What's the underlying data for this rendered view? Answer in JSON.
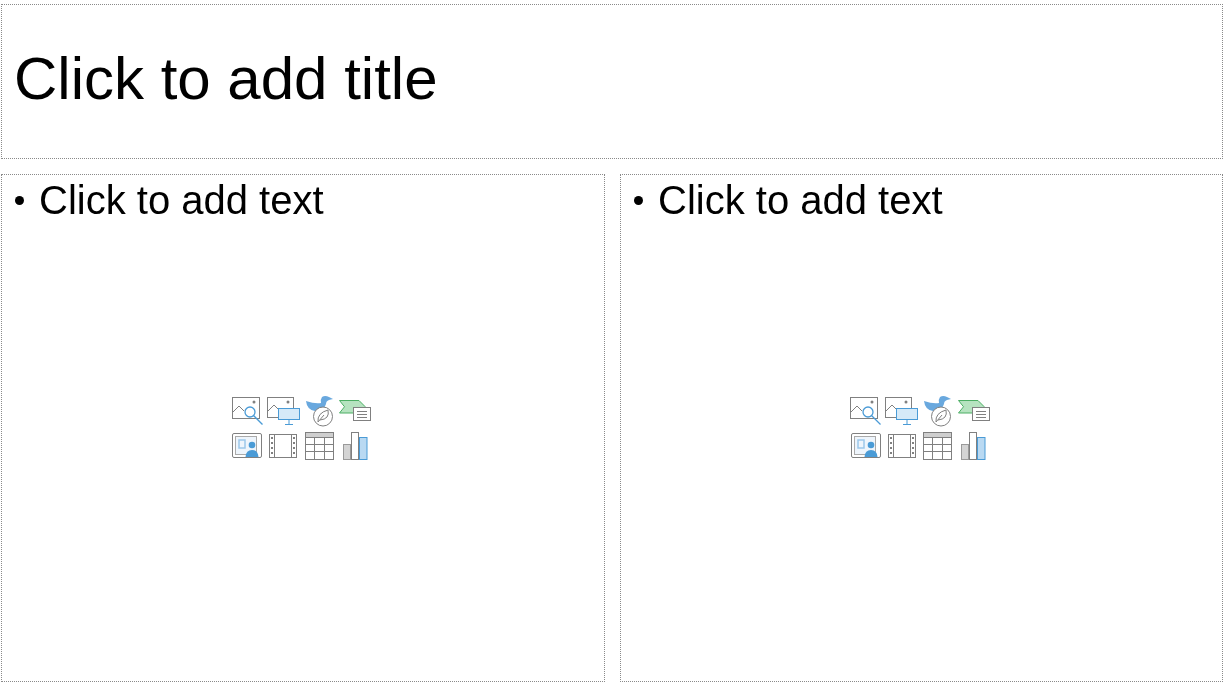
{
  "slide": {
    "title_placeholder": {
      "text": "Click to add title"
    },
    "content_placeholders": [
      {
        "bullet_text": "Click to add text"
      },
      {
        "bullet_text": "Click to add text"
      }
    ]
  }
}
